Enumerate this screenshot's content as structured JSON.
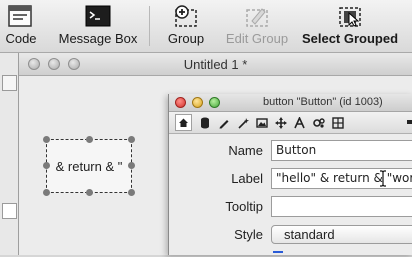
{
  "toolbar": {
    "code_label": "Code",
    "message_box_label": "Message Box",
    "group_label": "Group",
    "edit_group_label": "Edit Group",
    "select_grouped_label": "Select Grouped"
  },
  "document_window": {
    "title": "Untitled 1 *"
  },
  "canvas_button": {
    "label": "& return & \""
  },
  "inspector": {
    "title": "button \"Button\" (id 1003)",
    "properties": {
      "name_label": "Name",
      "name_value": "Button",
      "label_label": "Label",
      "label_value": "\"hello\" & return & \"world",
      "tooltip_label": "Tooltip",
      "tooltip_value": "",
      "style_label": "Style",
      "style_value": "standard"
    }
  },
  "colors": {
    "toolbar_bg": "#dcdcdc",
    "selection_handle": "#7a7a7a",
    "close_button": "#d2322c",
    "minimize_button": "#d6a21c",
    "zoom_button": "#45a83a"
  }
}
